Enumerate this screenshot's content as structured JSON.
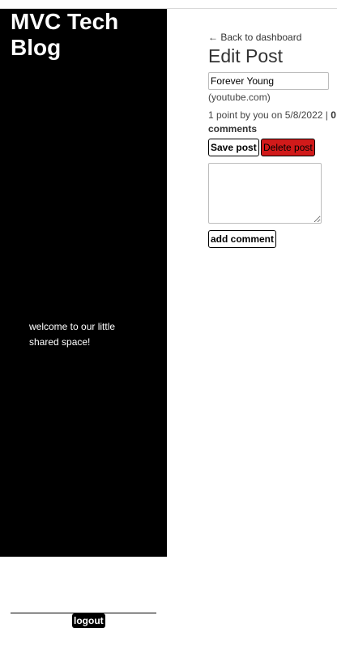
{
  "site": {
    "title": "MVC Tech Blog",
    "tagline": "welcome to our little shared space!"
  },
  "nav": {
    "back_label": "← Back to dashboard",
    "logout_label": "logout"
  },
  "editor": {
    "heading": "Edit Post",
    "title_value": "Forever Young",
    "domain": "(youtube.com)",
    "meta_prefix": "1 point by you on 5/8/2022 |",
    "comment_count": "0 comments",
    "save_label": "Save post",
    "delete_label": "Delete post",
    "comment_value": "",
    "add_comment_label": "add comment"
  },
  "colors": {
    "sidebar_bg": "#000000",
    "delete_bg": "#d11a1a"
  }
}
